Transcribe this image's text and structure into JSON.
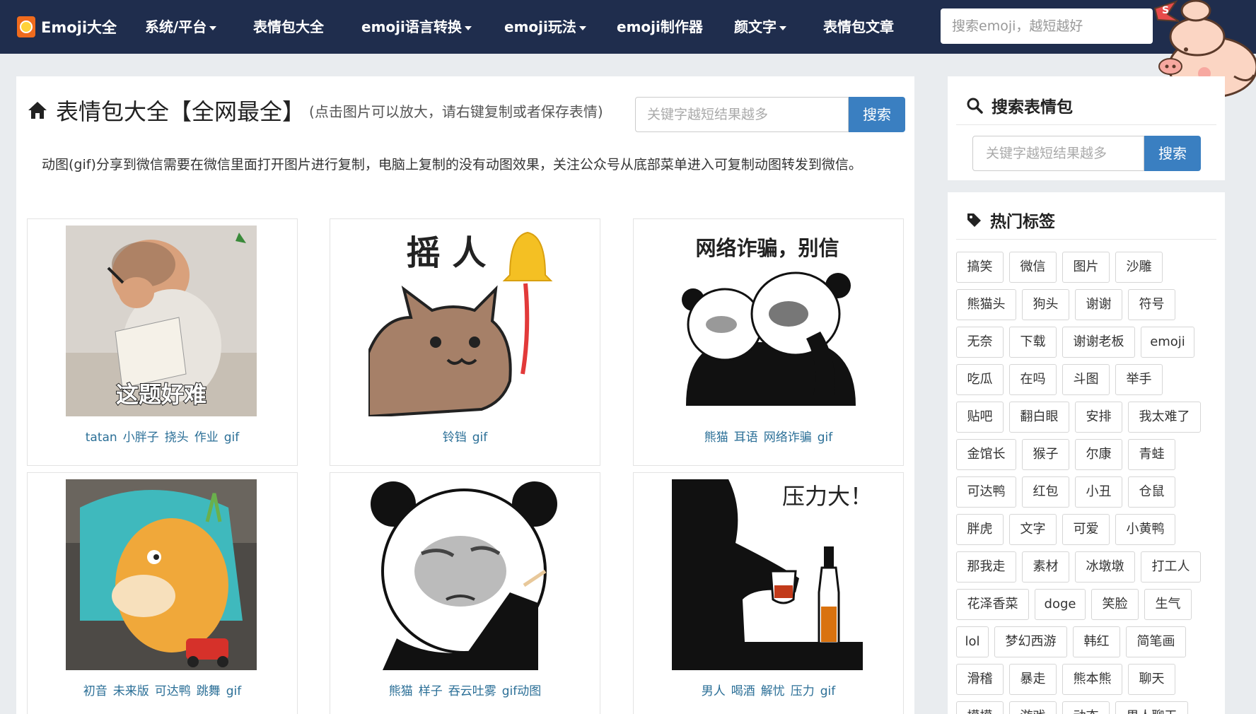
{
  "navbar": {
    "brand": "Emoji大全",
    "items": [
      "系统/平台",
      "表情包大全",
      "emoji语言转换",
      "emoji玩法",
      "emoji制作器",
      "颜文字",
      "表情包文章"
    ],
    "search_placeholder": "搜索emoji，越短越好"
  },
  "main": {
    "title": "表情包大全【全网最全】",
    "subtitle": "(点击图片可以放大，请右键复制或者保存表情)",
    "search_placeholder": "关键字越短结果越多",
    "search_button": "搜索",
    "notice": "动图(gif)分享到微信需要在微信里面打开图片进行复制，电脑上复制的没有动图效果，关注公众号从底部菜单进入可复制动图转发到微信。",
    "tiles": [
      {
        "caption": "这题好难",
        "tags": [
          "tatan",
          "小胖子",
          "挠头",
          "作业",
          "gif"
        ]
      },
      {
        "caption": "摇 人",
        "tags": [
          "铃铛",
          "gif"
        ]
      },
      {
        "caption": "网络诈骗，别信",
        "tags": [
          "熊猫",
          "耳语",
          "网络诈骗",
          "gif"
        ]
      },
      {
        "caption": "",
        "tags": [
          "初音",
          "未来版",
          "可达鸭",
          "跳舞",
          "gif"
        ]
      },
      {
        "caption": "",
        "tags": [
          "熊猫",
          "样子",
          "吞云吐雾",
          "gif动图"
        ]
      },
      {
        "caption": "压力大！",
        "tags": [
          "男人",
          "喝酒",
          "解忧",
          "压力",
          "gif"
        ]
      }
    ]
  },
  "sidebar": {
    "search_title": "搜索表情包",
    "search_placeholder": "关键字越短结果越多",
    "search_button": "搜索",
    "tags_title": "热门标签",
    "tags": [
      [
        "搞笑",
        "微信",
        "图片",
        "沙雕"
      ],
      [
        "熊猫头",
        "狗头",
        "谢谢",
        "符号"
      ],
      [
        "无奈",
        "下载",
        "谢谢老板",
        "emoji"
      ],
      [
        "吃瓜",
        "在吗",
        "斗图",
        "举手"
      ],
      [
        "贴吧",
        "翻白眼",
        "安排",
        "我太难了"
      ],
      [
        "金馆长",
        "猴子",
        "尔康",
        "青蛙"
      ],
      [
        "可达鸭",
        "红包",
        "小丑",
        "仓鼠"
      ],
      [
        "胖虎",
        "文字",
        "可爱",
        "小黄鸭"
      ],
      [
        "那我走",
        "素材",
        "冰墩墩",
        "打工人"
      ],
      [
        "花泽香菜",
        "doge",
        "笑脸",
        "生气"
      ],
      [
        "lol",
        "梦幻西游",
        "韩红",
        "简笔画"
      ],
      [
        "滑稽",
        "暴走",
        "熊本熊",
        "聊天"
      ],
      [
        "摸摸",
        "游戏",
        "动态",
        "男人聊天"
      ]
    ]
  },
  "colors": {
    "navbar": "#1f2d4d",
    "accent": "#3a7fc1",
    "tag_link": "#2b6f97"
  }
}
